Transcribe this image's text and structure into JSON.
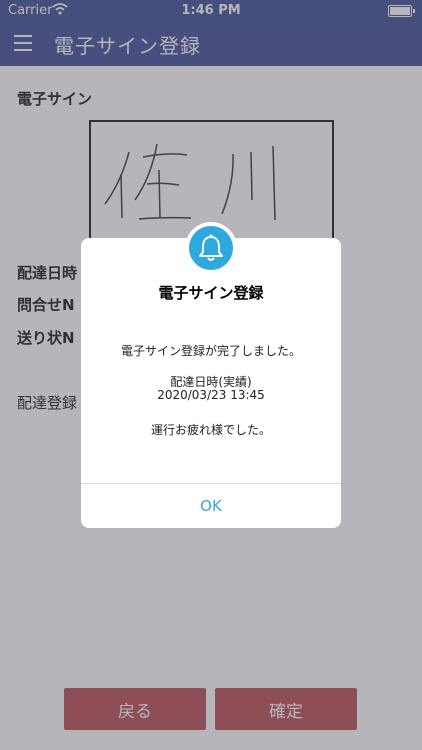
{
  "status_bar": {
    "carrier": "Carrier",
    "time": "1:46 PM"
  },
  "nav": {
    "title": "電子サイン登録"
  },
  "form": {
    "signature_label": "電子サイン",
    "fields": [
      "配達日時",
      "問合せN",
      "送り状N",
      "配達登録"
    ]
  },
  "buttons": {
    "back": "戻る",
    "confirm": "確定"
  },
  "dialog": {
    "title": "電子サイン登録",
    "message": "電子サイン登録が完了しました。",
    "datetime_label": "配達日時(実績)",
    "datetime_value": "2020/03/23 13:45",
    "closing": "運行お疲れ様でした。",
    "ok": "OK"
  },
  "colors": {
    "nav": "#2e3d8f",
    "accent": "#2ea9dd",
    "button": "#b23a41"
  },
  "icons": [
    "menu-icon",
    "wifi-icon",
    "battery-icon",
    "bell-icon"
  ]
}
